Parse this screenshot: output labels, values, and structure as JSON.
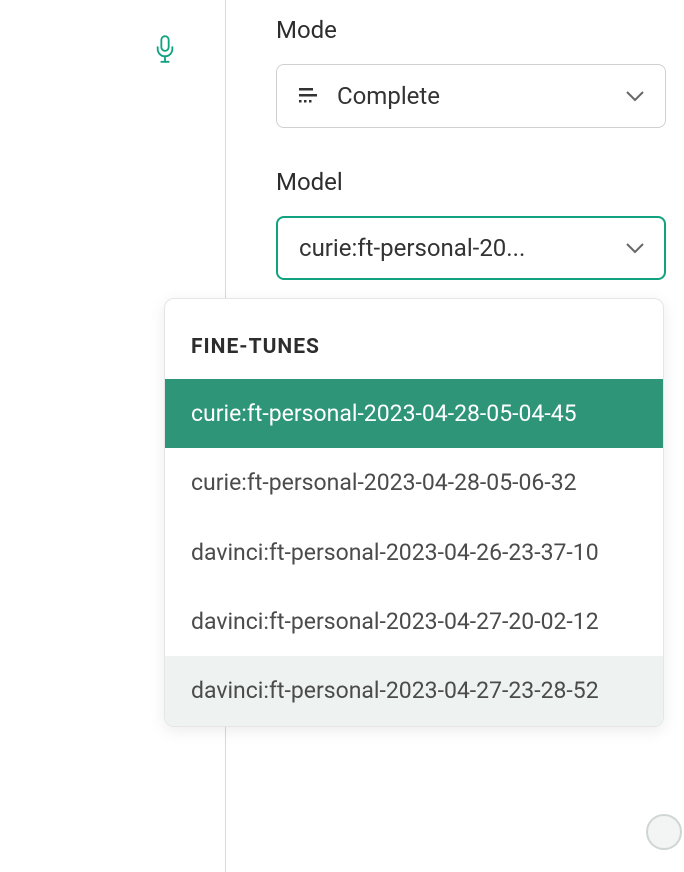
{
  "mode": {
    "label": "Mode",
    "selected": "Complete"
  },
  "model": {
    "label": "Model",
    "input_display": "curie:ft-personal-20..."
  },
  "dropdown": {
    "section_title": "FINE-TUNES",
    "items": [
      {
        "label": "curie:ft-personal-2023-04-28-05-04-45",
        "selected": true,
        "hovered": false
      },
      {
        "label": "curie:ft-personal-2023-04-28-05-06-32",
        "selected": false,
        "hovered": false
      },
      {
        "label": "davinci:ft-personal-2023-04-26-23-37-10",
        "selected": false,
        "hovered": false
      },
      {
        "label": "davinci:ft-personal-2023-04-27-20-02-12",
        "selected": false,
        "hovered": false
      },
      {
        "label": "davinci:ft-personal-2023-04-27-23-28-52",
        "selected": false,
        "hovered": true
      }
    ]
  }
}
